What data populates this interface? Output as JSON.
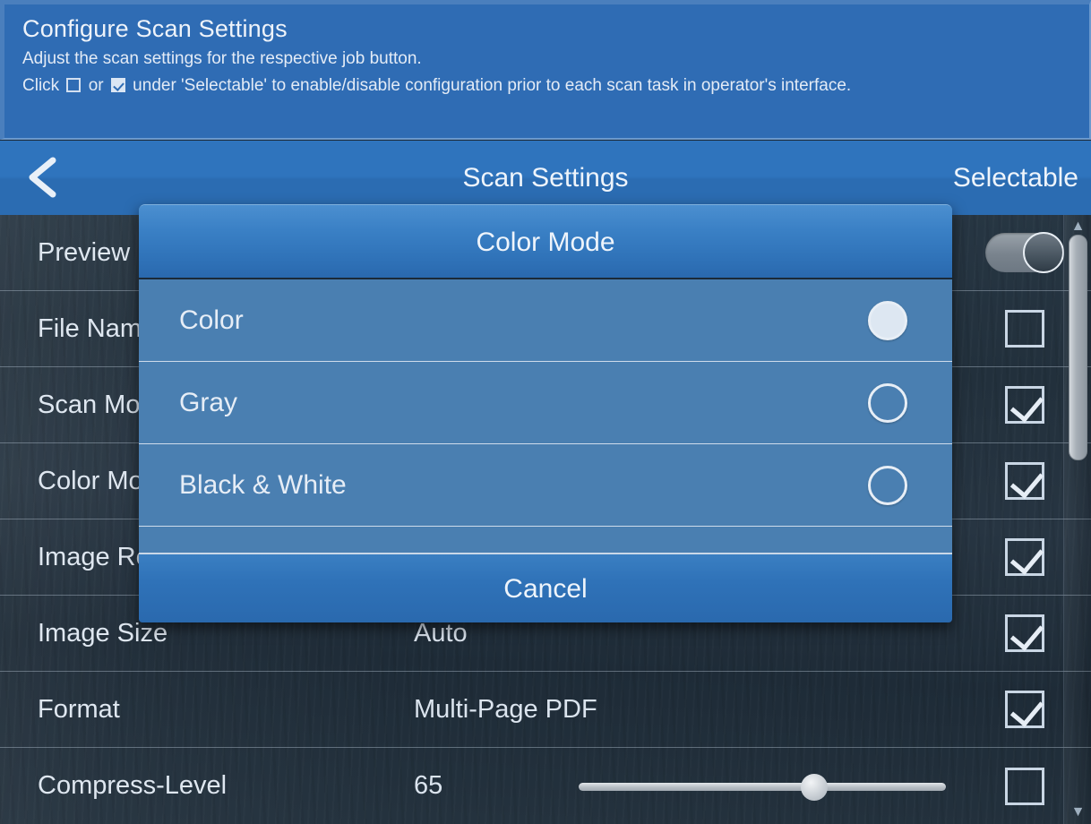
{
  "banner": {
    "title": "Configure Scan Settings",
    "line1": "Adjust the scan settings for the respective job button.",
    "line2_a": "Click ",
    "line2_b": " or ",
    "line2_c": " under 'Selectable' to enable/disable configuration prior to each scan task in operator's interface."
  },
  "navbar": {
    "back_icon": "chevron-left-icon",
    "title": "Scan Settings",
    "right_label": "Selectable"
  },
  "settings": {
    "rows": [
      {
        "label": "Preview",
        "value": "",
        "control": "toggle",
        "state": "on"
      },
      {
        "label": "File Name",
        "value": "",
        "control": "checkbox",
        "state": "off"
      },
      {
        "label": "Scan Mode",
        "value": "",
        "control": "checkbox",
        "state": "on"
      },
      {
        "label": "Color Mode",
        "value": "",
        "control": "checkbox",
        "state": "on"
      },
      {
        "label": "Image Resolution",
        "value": "",
        "control": "checkbox",
        "state": "on"
      },
      {
        "label": "Image Size",
        "value": "Auto",
        "control": "checkbox",
        "state": "on"
      },
      {
        "label": "Format",
        "value": "Multi-Page PDF",
        "control": "checkbox",
        "state": "on"
      },
      {
        "label": "Compress-Level",
        "value": "65",
        "control": "checkbox",
        "state": "off",
        "slider": 65
      }
    ]
  },
  "scrollbar": {
    "up_icon": "chevron-up-icon",
    "down_icon": "chevron-down-icon"
  },
  "dialog": {
    "title": "Color Mode",
    "options": [
      {
        "label": "Color",
        "selected": true
      },
      {
        "label": "Gray",
        "selected": false
      },
      {
        "label": "Black & White",
        "selected": false
      }
    ],
    "cancel_label": "Cancel"
  },
  "colors": {
    "banner_bg": "#2f6cb4",
    "navbar_bg": "#2f74bd",
    "list_bg": "#25333f",
    "dialog_body": "#4a7fb1",
    "dialog_header": "#3a80c5",
    "text": "#e6edf6"
  }
}
